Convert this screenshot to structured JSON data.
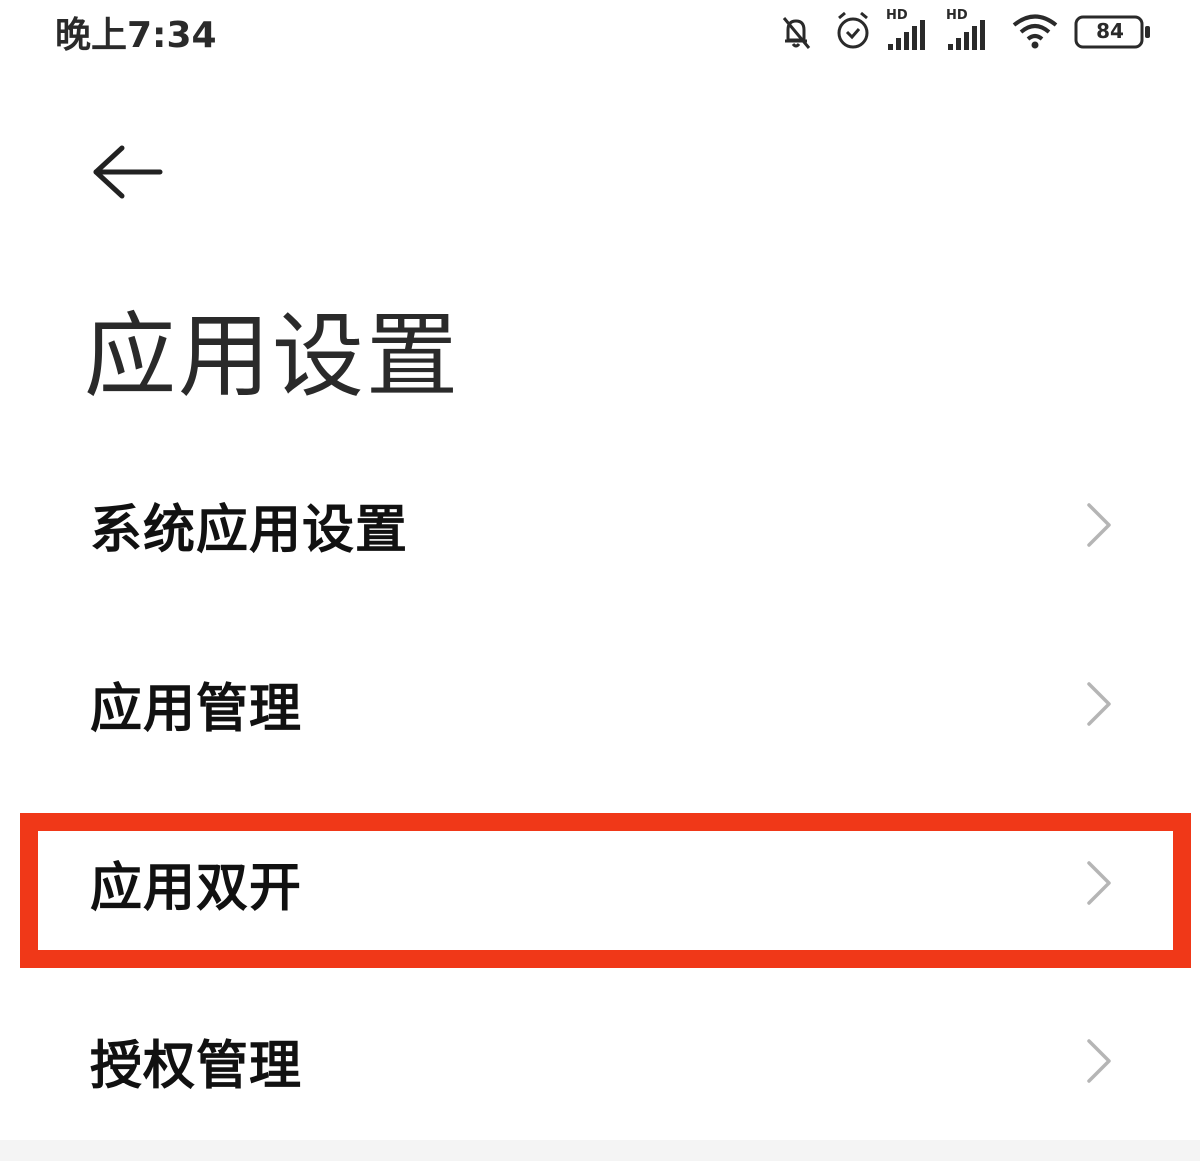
{
  "status_bar": {
    "time": "晚上7:34",
    "signal_label_1": "HD",
    "signal_label_2": "HD",
    "battery": "84",
    "icons": [
      "mute-bell-icon",
      "alarm-icon",
      "signal-icon",
      "signal-icon",
      "wifi-icon",
      "battery-icon"
    ]
  },
  "header": {
    "back_icon": "back-arrow-icon",
    "title": "应用设置"
  },
  "list": {
    "items": [
      {
        "label": "系统应用设置",
        "icon": "chevron-right-icon"
      },
      {
        "label": "应用管理",
        "icon": "chevron-right-icon"
      },
      {
        "label": "应用双开",
        "icon": "chevron-right-icon",
        "highlighted": true
      },
      {
        "label": "授权管理",
        "icon": "chevron-right-icon"
      }
    ]
  },
  "colors": {
    "highlight": "#f03818",
    "text": "#111111",
    "chevron": "#b5b5b5",
    "background": "#ffffff"
  }
}
